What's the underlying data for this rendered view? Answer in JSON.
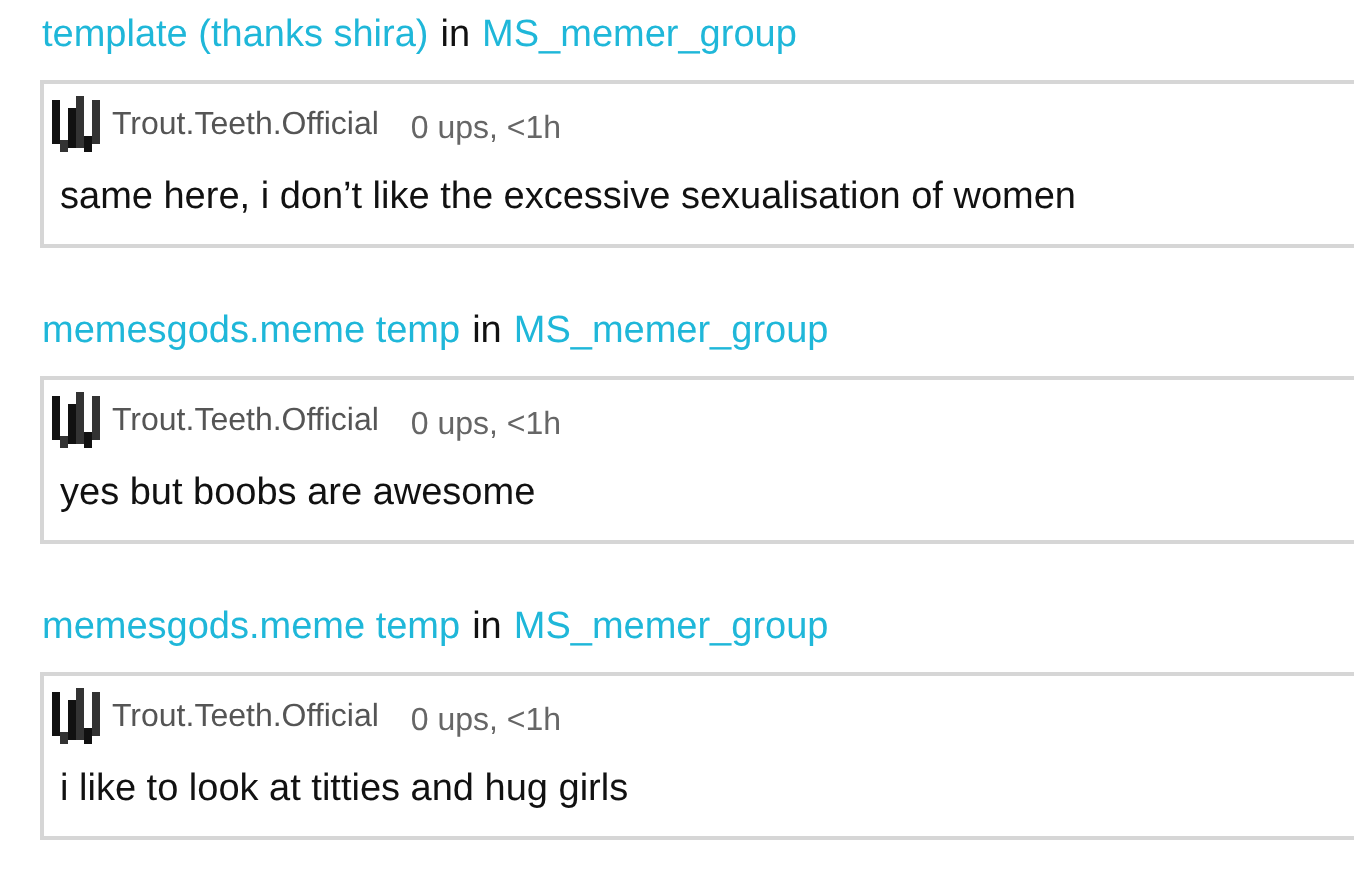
{
  "posts": [
    {
      "title": "template (thanks shira)",
      "connector": "in",
      "group": "MS_memer_group",
      "comment": {
        "author": "Trout.Teeth.Official",
        "meta": "0 ups, <1h",
        "text": "same here, i don’t like the excessive sexualisation of women"
      }
    },
    {
      "title": "memesgods.meme temp",
      "connector": "in",
      "group": "MS_memer_group",
      "comment": {
        "author": "Trout.Teeth.Official",
        "meta": "0 ups, <1h",
        "text": "yes but boobs are awesome"
      }
    },
    {
      "title": "memesgods.meme temp",
      "connector": "in",
      "group": "MS_memer_group",
      "comment": {
        "author": "Trout.Teeth.Official",
        "meta": "0 ups, <1h",
        "text": "i like to look at titties and hug girls"
      }
    }
  ]
}
